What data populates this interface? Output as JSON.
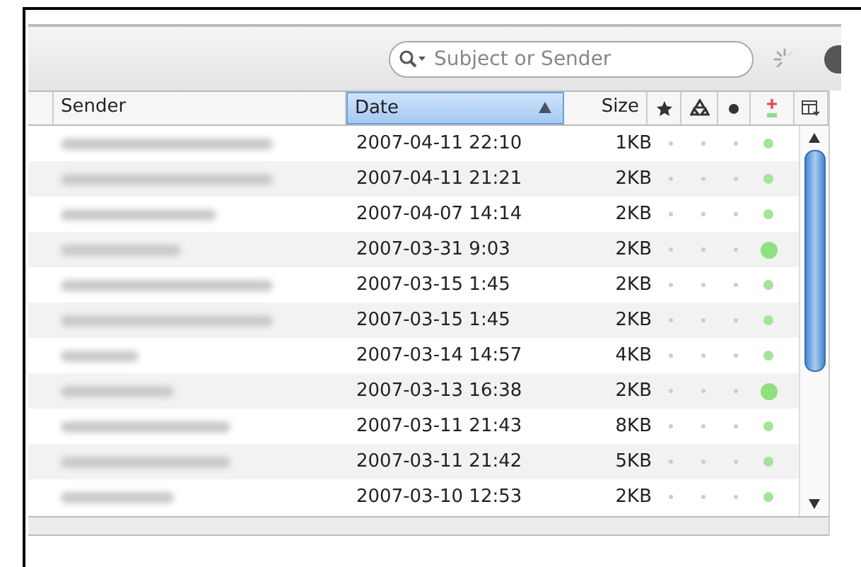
{
  "search": {
    "placeholder": "Subject or Sender"
  },
  "columns": [
    {
      "label": "Sender",
      "selected": false
    },
    {
      "label": "Date",
      "selected": true
    },
    {
      "label": "Size",
      "selected": false
    }
  ],
  "rows": [
    {
      "date": "2007-04-11 22:10",
      "size": "1KB",
      "marked": false
    },
    {
      "date": "2007-04-11 21:21",
      "size": "2KB",
      "marked": false
    },
    {
      "date": "2007-04-07 14:14",
      "size": "2KB",
      "marked": false
    },
    {
      "date": "2007-03-31 9:03",
      "size": "2KB",
      "marked": true
    },
    {
      "date": "2007-03-15 1:45",
      "size": "2KB",
      "marked": false
    },
    {
      "date": "2007-03-15 1:45",
      "size": "2KB",
      "marked": false
    },
    {
      "date": "2007-03-14 14:57",
      "size": "4KB",
      "marked": false
    },
    {
      "date": "2007-03-13 16:38",
      "size": "2KB",
      "marked": true
    },
    {
      "date": "2007-03-11 21:43",
      "size": "8KB",
      "marked": false
    },
    {
      "date": "2007-03-11 21:42",
      "size": "5KB",
      "marked": false
    },
    {
      "date": "2007-03-10 12:53",
      "size": "2KB",
      "marked": false
    }
  ]
}
